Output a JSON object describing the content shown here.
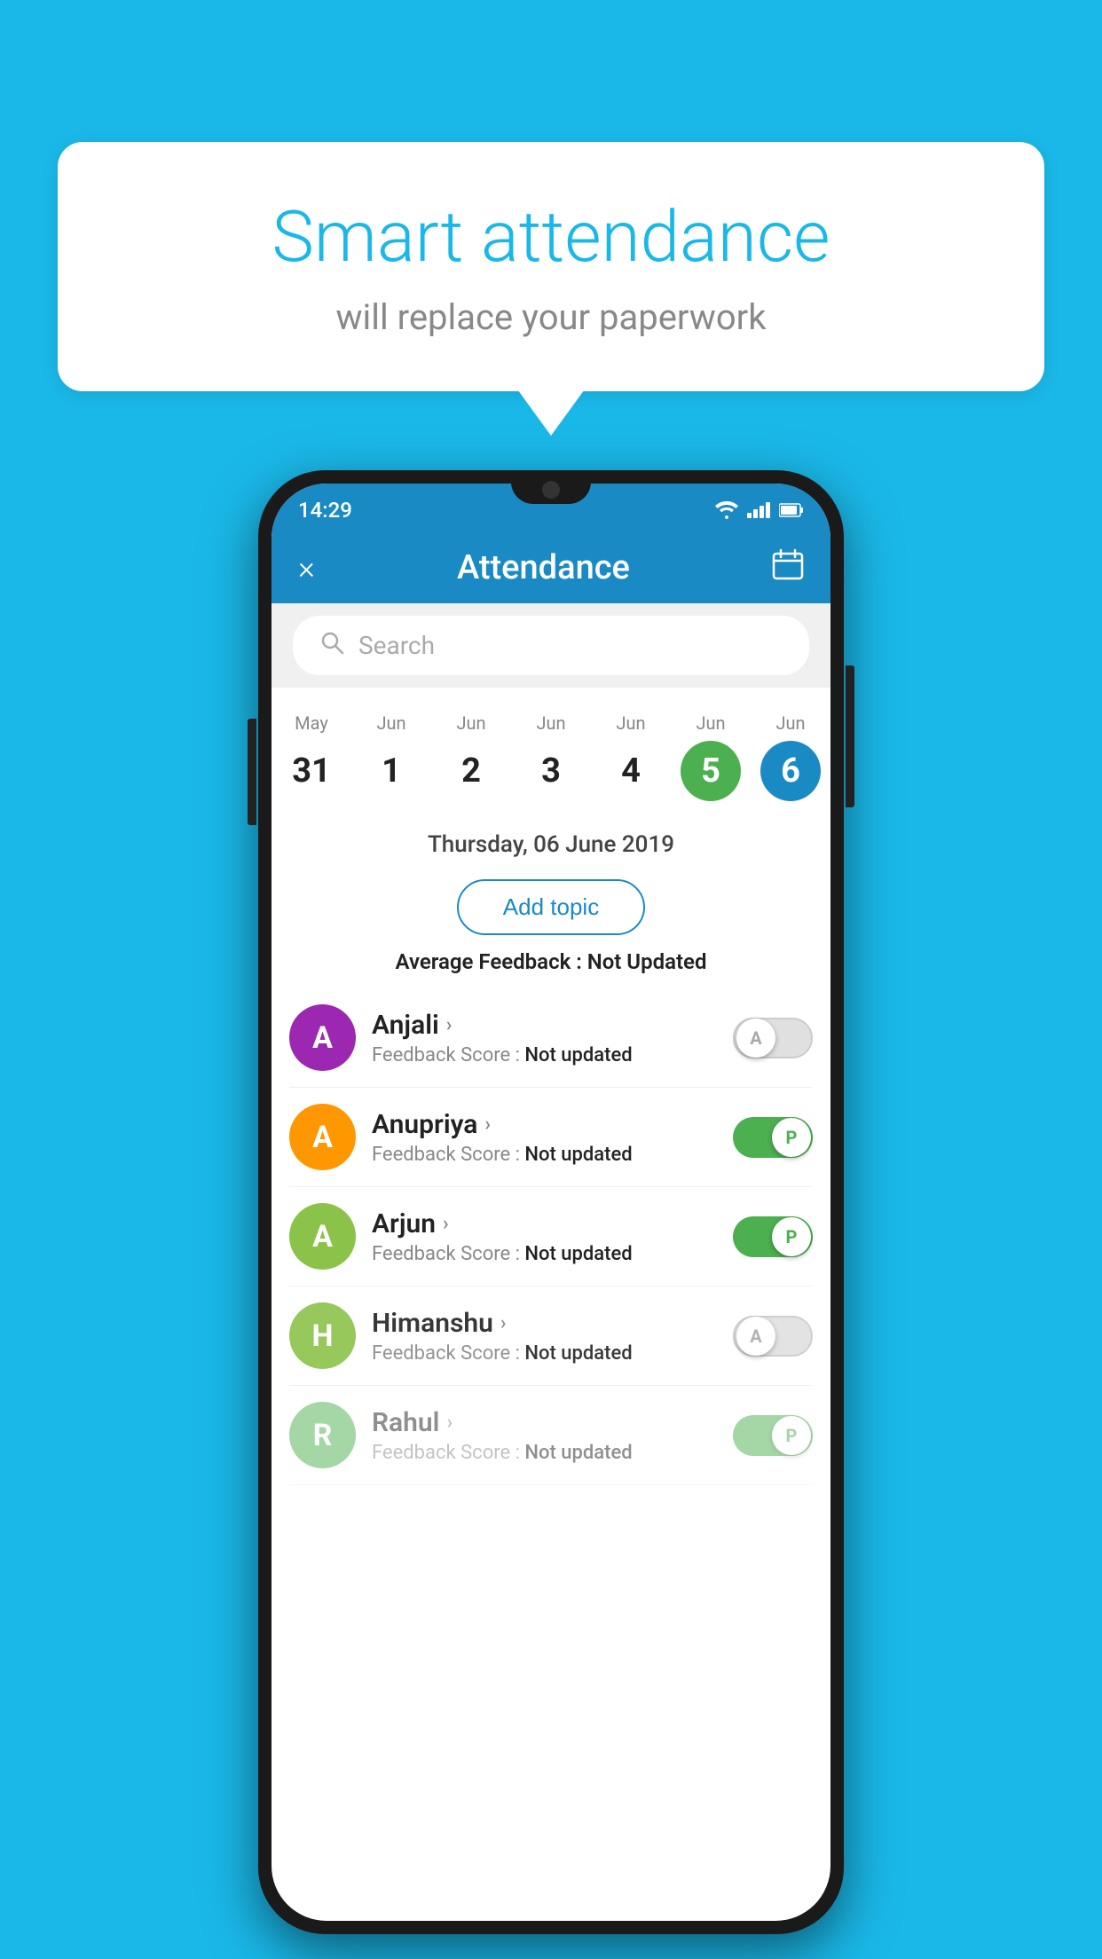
{
  "background_color": "#1ab8e8",
  "speech_bubble": {
    "title": "Smart attendance",
    "subtitle": "will replace your paperwork"
  },
  "phone": {
    "status_bar": {
      "time": "14:29"
    },
    "header": {
      "title": "Attendance",
      "close_label": "×",
      "calendar_icon": "calendar"
    },
    "search": {
      "placeholder": "Search"
    },
    "calendar": {
      "days": [
        {
          "month": "May",
          "date": "31",
          "state": "normal"
        },
        {
          "month": "Jun",
          "date": "1",
          "state": "normal"
        },
        {
          "month": "Jun",
          "date": "2",
          "state": "normal"
        },
        {
          "month": "Jun",
          "date": "3",
          "state": "normal"
        },
        {
          "month": "Jun",
          "date": "4",
          "state": "normal"
        },
        {
          "month": "Jun",
          "date": "5",
          "state": "today"
        },
        {
          "month": "Jun",
          "date": "6",
          "state": "selected"
        }
      ]
    },
    "selected_date_label": "Thursday, 06 June 2019",
    "add_topic_label": "Add topic",
    "average_feedback_label": "Average Feedback :",
    "average_feedback_value": "Not Updated",
    "students": [
      {
        "name": "Anjali",
        "initial": "A",
        "avatar_color": "#9c27b0",
        "feedback_label": "Feedback Score :",
        "feedback_value": "Not updated",
        "toggle_state": "inactive",
        "toggle_label": "A"
      },
      {
        "name": "Anupriya",
        "initial": "A",
        "avatar_color": "#ff9800",
        "feedback_label": "Feedback Score :",
        "feedback_value": "Not updated",
        "toggle_state": "active",
        "toggle_label": "P"
      },
      {
        "name": "Arjun",
        "initial": "A",
        "avatar_color": "#8bc34a",
        "feedback_label": "Feedback Score :",
        "feedback_value": "Not updated",
        "toggle_state": "active",
        "toggle_label": "P"
      },
      {
        "name": "Himanshu",
        "initial": "H",
        "avatar_color": "#8bc34a",
        "feedback_label": "Feedback Score :",
        "feedback_value": "Not updated",
        "toggle_state": "inactive",
        "toggle_label": "A"
      },
      {
        "name": "Rahul",
        "initial": "R",
        "avatar_color": "#4caf50",
        "feedback_label": "Feedback Score :",
        "feedback_value": "Not updated",
        "toggle_state": "active",
        "toggle_label": "P"
      }
    ]
  }
}
